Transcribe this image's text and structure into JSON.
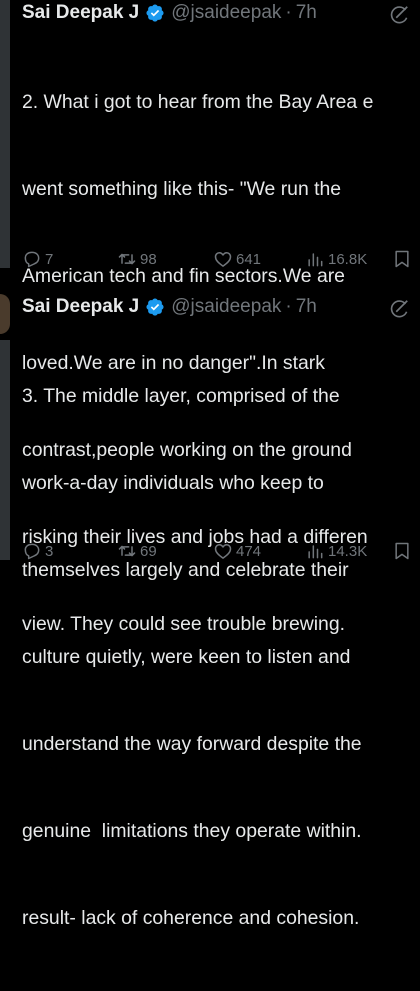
{
  "tweets": [
    {
      "author_name": "Sai Deepak J",
      "handle": "@jsaideepak",
      "separator": "·",
      "time": "7h",
      "lines": [
        "2. What i got to hear from the Bay Area e",
        "went something like this- \"We run the",
        "American tech and fin sectors.We are",
        "loved.We are in no danger\".In stark",
        "contrast,people working on the ground",
        "risking their lives and jobs had a differen",
        "view. They could see trouble brewing."
      ],
      "replies": "7",
      "reposts": "98",
      "likes": "641",
      "views": "16.8K"
    },
    {
      "author_name": "Sai Deepak J",
      "handle": "@jsaideepak",
      "separator": "·",
      "time": "7h",
      "lines": [
        "3. The middle layer, comprised of the",
        "work-a-day individuals who keep to",
        "themselves largely and celebrate their",
        "culture quietly, were keen to listen and",
        "understand the way forward despite the",
        "genuine  limitations they operate within.",
        "result- lack of coherence and cohesion."
      ],
      "replies": "3",
      "reposts": "69",
      "likes": "474",
      "views": "14.3K"
    }
  ],
  "colors": {
    "background": "#000000",
    "text": "#e7e9ea",
    "secondary": "#71767b",
    "verified_badge": "#1d9bf0"
  },
  "icons": {
    "verified": "verified-badge-icon",
    "more": "grok-icon",
    "reply": "reply-icon",
    "repost": "repost-icon",
    "like": "like-icon",
    "views": "views-icon",
    "bookmark": "bookmark-icon"
  }
}
